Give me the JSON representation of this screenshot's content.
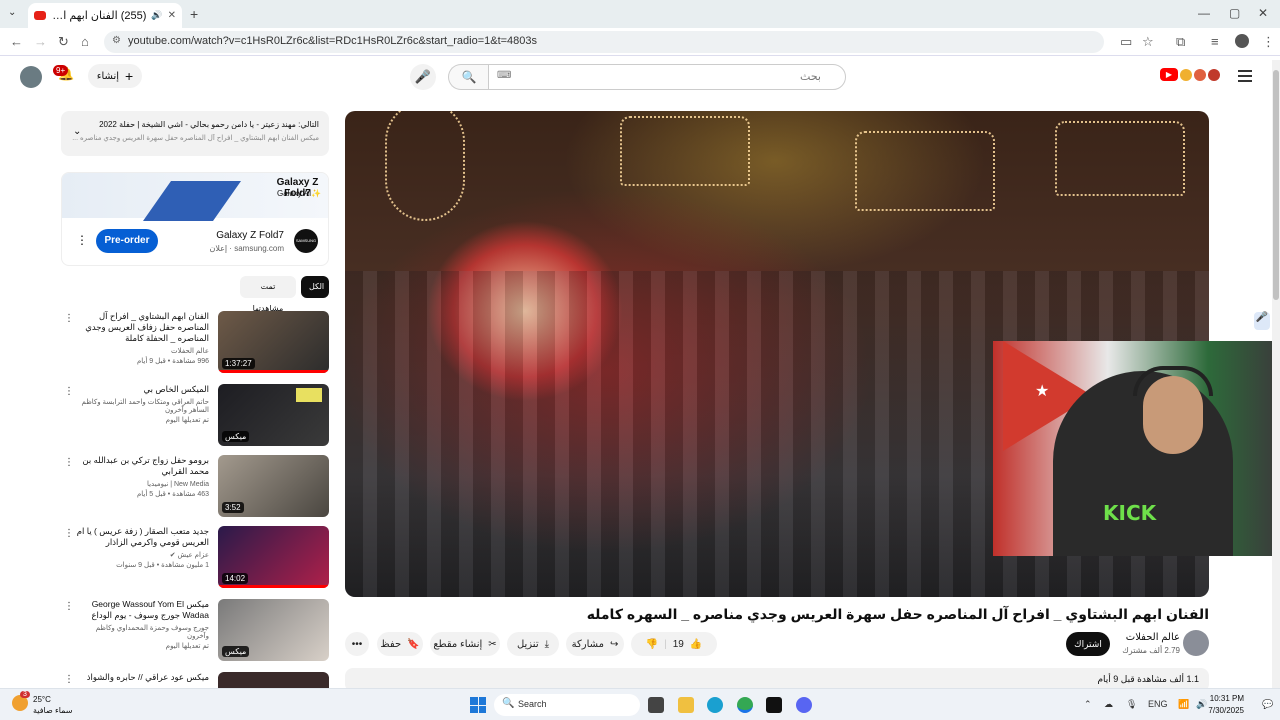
{
  "browser": {
    "tab_title": "(255) الفنان ابهم البشتاوي _",
    "new_tab": "+",
    "url": "youtube.com/watch?v=c1HsR0LZr6c&list=RDc1HsR0LZr6c&start_radio=1&t=4803s",
    "win_min": "—",
    "win_max": "▢",
    "win_close": "✕"
  },
  "header": {
    "create_label": "إنشاء",
    "notif_count": "9+",
    "search_placeholder": "بحث"
  },
  "playlist": {
    "line1": "التالي: مهند زعيتر - يا دامن رحمو بحالي - اشي الشيخة | حفلة 2022",
    "line2": "ميكس الفنان ابهم البشتاوي _ افراح آل المناصره حفل سهرة العريس وجدي مناصره ..."
  },
  "ad": {
    "brand": "Galaxy Z Fold7",
    "sub": "Galaxy AI✨",
    "cta": "Pre-order",
    "title": "Galaxy Z Fold7",
    "url": "samsung.com · إعلان",
    "logo": "SAMSUNG"
  },
  "chips": {
    "all": "الكل",
    "watched": "تمت مشاهدتها"
  },
  "recommendations": [
    {
      "title": "الفنان ابهم البشتاوي _ افراح آل المناصره حفل زفاف العريس وجدي المناصره _ الحفلة كاملة",
      "channel": "عالم الحفلات",
      "meta": "996 مشاهدة • قبل 9 أيام",
      "duration": "1:37:27"
    },
    {
      "title": "الميكس الخاص بي",
      "channel": "حاتم العراقي ومتكات واحمد الترابسة وكاظم الساهر وآخرون",
      "meta": "تم تعديلها اليوم",
      "duration": "ميكس"
    },
    {
      "title": "برومو حفل زواج تركي بن عبدالله بن محمد القرابي",
      "channel": "New Media | نيوميديا",
      "meta": "463 مشاهدة • قبل 5 أيام",
      "duration": "3:52"
    },
    {
      "title": "جديد متعب الصقار ( زفة عريس ) يا ام العريس قومي واكرمي الزاذار",
      "channel": "عزام عيش ✔",
      "meta": "1 مليون مشاهدة • قبل 9 سنوات",
      "duration": "14:02"
    },
    {
      "title": "ميكس George Wassouf Yom El Wadaa جورج وسوف - يوم الوداع",
      "channel": "جورج وسوف وحمزة المحمداوي وكاظم وآخرون",
      "meta": "تم تعديلها اليوم",
      "duration": "ميكس"
    },
    {
      "title": "ميكس عود عراقي // حابره والشواذ بين",
      "channel": "",
      "meta": "",
      "duration": ""
    }
  ],
  "video": {
    "title": "الفنان ابهم البشتاوي _ افراح آل المناصره حفل سهرة العريس وجدي مناصره _ السهره كامله",
    "channel": "عالم الحفلات",
    "subs": "2.79 ألف مشترك",
    "subscribe": "اشتراك",
    "likes": "19",
    "share": "مشاركة",
    "download": "تنزيل",
    "clip": "إنشاء مقطع",
    "save": "حفظ",
    "more": "•••",
    "desc_meta": "1.1 ألف مشاهدة قبل 9 أيام"
  },
  "taskbar": {
    "temp": "25°C",
    "weather": "سماء صافية",
    "search": "Search",
    "lang": "ENG",
    "time": "10:31 PM",
    "date": "7/30/2025",
    "weather_badge": "3"
  }
}
